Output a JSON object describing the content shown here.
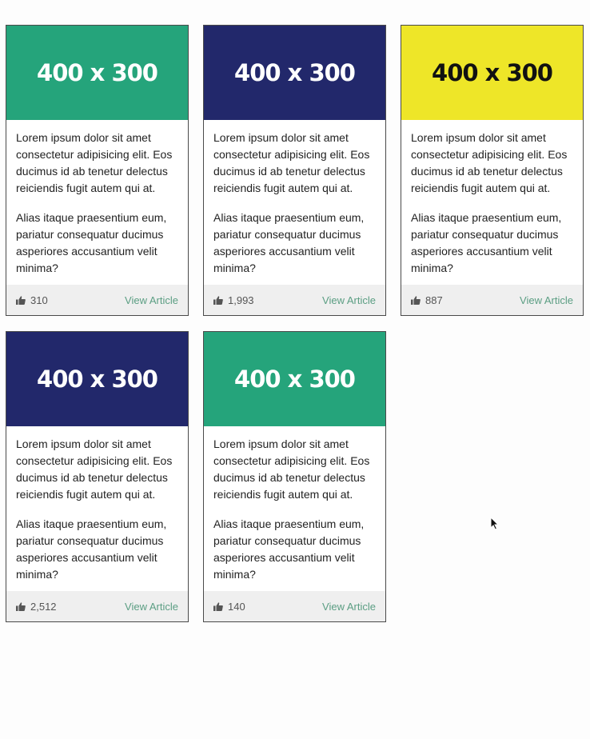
{
  "cards": [
    {
      "image_label": "400 x 300",
      "image_bg": "#25a47b",
      "image_fg": "#ffffff",
      "paragraph1": "Lorem ipsum dolor sit amet consectetur adipisicing elit. Eos ducimus id ab tenetur delectus reiciendis fugit autem qui at.",
      "paragraph2": "Alias itaque praesentium eum, pariatur consequatur ducimus asperiores accusantium velit minima?",
      "likes": "310",
      "link_label": "View Article"
    },
    {
      "image_label": "400 x 300",
      "image_bg": "#22286b",
      "image_fg": "#ffffff",
      "paragraph1": "Lorem ipsum dolor sit amet consectetur adipisicing elit. Eos ducimus id ab tenetur delectus reiciendis fugit autem qui at.",
      "paragraph2": "Alias itaque praesentium eum, pariatur consequatur ducimus asperiores accusantium velit minima?",
      "likes": "1,993",
      "link_label": "View Article"
    },
    {
      "image_label": "400 x 300",
      "image_bg": "#eee628",
      "image_fg": "#111111",
      "paragraph1": "Lorem ipsum dolor sit amet consectetur adipisicing elit. Eos ducimus id ab tenetur delectus reiciendis fugit autem qui at.",
      "paragraph2": "Alias itaque praesentium eum, pariatur consequatur ducimus asperiores accusantium velit minima?",
      "likes": "887",
      "link_label": "View Article"
    },
    {
      "image_label": "400 x 300",
      "image_bg": "#22286b",
      "image_fg": "#ffffff",
      "paragraph1": "Lorem ipsum dolor sit amet consectetur adipisicing elit. Eos ducimus id ab tenetur delectus reiciendis fugit autem qui at.",
      "paragraph2": "Alias itaque praesentium eum, pariatur consequatur ducimus asperiores accusantium velit minima?",
      "likes": "2,512",
      "link_label": "View Article"
    },
    {
      "image_label": "400 x 300",
      "image_bg": "#25a47b",
      "image_fg": "#ffffff",
      "paragraph1": "Lorem ipsum dolor sit amet consectetur adipisicing elit. Eos ducimus id ab tenetur delectus reiciendis fugit autem qui at.",
      "paragraph2": "Alias itaque praesentium eum, pariatur consequatur ducimus asperiores accusantium velit minima?",
      "likes": "140",
      "link_label": "View Article"
    }
  ],
  "icons": {
    "likes": "thumbs-up-icon",
    "pointer": "mouse-cursor-icon"
  },
  "colors": {
    "link": "#5b9e83",
    "footer_bg": "#efefef",
    "card_border": "#4a4a4a"
  }
}
